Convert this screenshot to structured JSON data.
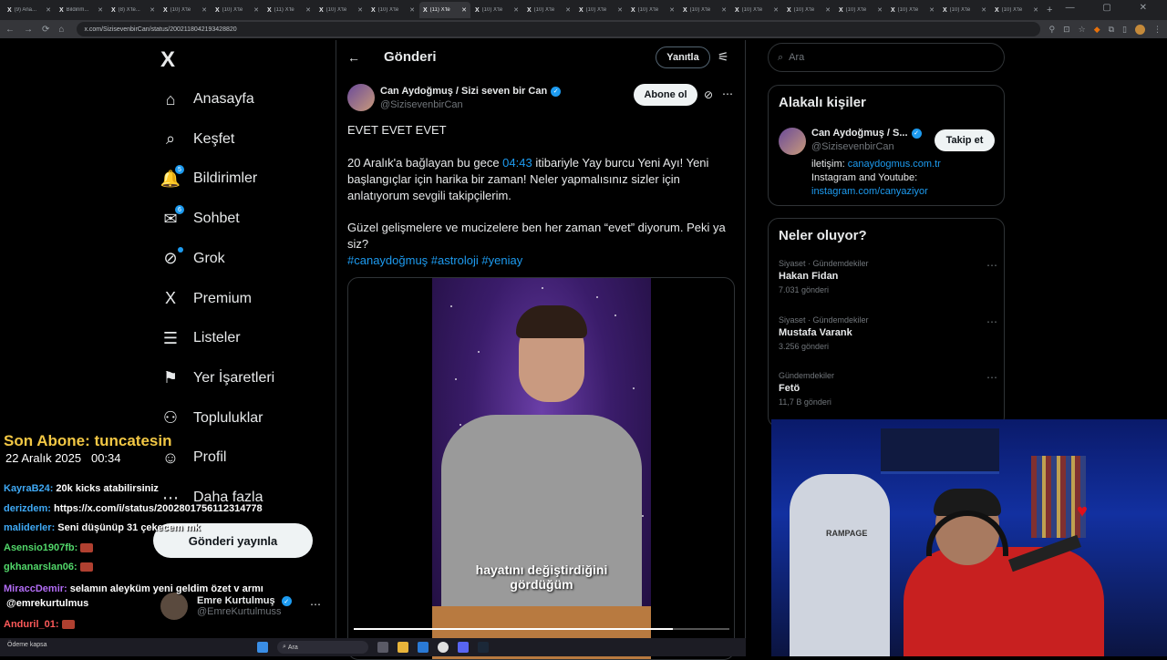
{
  "browser": {
    "tabs": [
      "(9) Ana...",
      "Bildirim...",
      "(8) X'te...",
      "(10) X'te",
      "(10) X'te",
      "(11) X'te",
      "(10) X'te",
      "(10) X'te",
      "(11) X'te",
      "(10) X'te",
      "(10) X'te",
      "(10) X'te",
      "(10) X'te",
      "(10) X'te",
      "(10) X'te",
      "(10) X'te",
      "(10) X'te",
      "(10) X'te",
      "(10) X'te",
      "(10) X'te"
    ],
    "active_tab_index": 8,
    "url": "x.com/SizisevenbirCan/status/2002118042193428820"
  },
  "nav": {
    "logo": "X",
    "items": [
      {
        "label": "Anasayfa",
        "icon": "home-icon",
        "glyph": "⌂"
      },
      {
        "label": "Keşfet",
        "icon": "search-icon",
        "glyph": "⌕"
      },
      {
        "label": "Bildirimler",
        "icon": "bell-icon",
        "glyph": "🔔",
        "badge": "5"
      },
      {
        "label": "Sohbet",
        "icon": "mail-icon",
        "glyph": "✉",
        "badge": "6"
      },
      {
        "label": "Grok",
        "icon": "grok-icon",
        "glyph": "⊘",
        "dot": true
      },
      {
        "label": "Premium",
        "icon": "x-premium-icon",
        "glyph": "X"
      },
      {
        "label": "Listeler",
        "icon": "list-icon",
        "glyph": "☰"
      },
      {
        "label": "Yer İşaretleri",
        "icon": "bookmark-icon",
        "glyph": "⚑"
      },
      {
        "label": "Topluluklar",
        "icon": "communities-icon",
        "glyph": "⚇"
      },
      {
        "label": "Profil",
        "icon": "profile-icon",
        "glyph": "☺"
      },
      {
        "label": "Daha fazla",
        "icon": "more-circle-icon",
        "glyph": "⋯"
      }
    ],
    "post_button": "Gönderi yayınla",
    "profile": {
      "name": "Emre Kurtulmuş",
      "handle": "@EmreKurtulmuss"
    }
  },
  "center": {
    "header_title": "Gönderi",
    "reply_button": "Yanıtla",
    "author": {
      "name": "Can Aydoğmuş / Sizi seven bir Can",
      "handle": "@SizisevenbirCan"
    },
    "subscribe_button": "Abone ol",
    "tweet": {
      "line1": "EVET EVET EVET",
      "p2a": "20 Aralık'a bağlayan bu gece ",
      "time": "04:43",
      "p2b": " itibariyle Yay burcu Yeni Ayı! Yeni başlangıçlar için harika bir zaman! Neler yapmalısınız sizler için anlatıyorum sevgili takipçilerim.",
      "p3": "Güzel gelişmelere ve mucizelere ben her zaman “evet” diyorum. Peki ya siz?",
      "hashtags": "#canaydoğmuş #astroloji #yeniay"
    },
    "video_caption_1": "hayatını değiştirdiğini",
    "video_caption_2": "gördüğüm",
    "video_progress": 0.85
  },
  "right": {
    "search_placeholder": "Ara",
    "related_title": "Alakalı kişiler",
    "related": {
      "name": "Can Aydoğmuş / S...",
      "handle": "@SizisevenbirCan",
      "follow_button": "Takip et",
      "bio_1_label": "iletişim: ",
      "bio_1_link": "canaydogmus.com.tr",
      "bio_2": "Instagram and Youtube:",
      "bio_3_link": "instagram.com/canyaziyor"
    },
    "trends_title": "Neler oluyor?",
    "trends": [
      {
        "category": "Siyaset · Gündemdekiler",
        "name": "Hakan Fidan",
        "count": "7.031 gönderi"
      },
      {
        "category": "Siyaset · Gündemdekiler",
        "name": "Mustafa Varank",
        "count": "3.256 gönderi"
      },
      {
        "category": "Gündemdekiler",
        "name": "Fetö",
        "count": "11,7 B gönderi"
      }
    ]
  },
  "overlay": {
    "last_sub": "Son Abone: tuncatesin",
    "date": "22 Aralık 2025",
    "time": "00:34",
    "chat": [
      {
        "user": "KayraB24:",
        "color": "#3fa9f5",
        "text": "20k kicks atabilirsiniz"
      },
      {
        "user": "derizdem:",
        "color": "#3fa9f5",
        "text": "https://x.com/i/status/2002801756112314778"
      },
      {
        "user": "maliderler:",
        "color": "#3fa9f5",
        "text": "Seni düşünüp 31 çekecem mk"
      },
      {
        "user": "Asensio1907fb:",
        "color": "#52d86a",
        "text": ""
      },
      {
        "user": "gkhanarslan06:",
        "color": "#52d86a",
        "text": ""
      },
      {
        "user": "MiraccDemir:",
        "color": "#b26cf5",
        "text": "selamın aleyküm yeni geldim özet v armı"
      },
      {
        "user": "",
        "color": "#fff",
        "text": "@emrekurtulmus"
      },
      {
        "user": "Anduril_01:",
        "color": "#ff5a5a",
        "text": ""
      },
      {
        "user": "Anduril_01:",
        "color": "#ff5a5a",
        "text": ""
      }
    ],
    "chair_brand": "RAMPAGE"
  },
  "taskbar": {
    "search": "Ara",
    "left_text": "Ödeme kapsa"
  }
}
